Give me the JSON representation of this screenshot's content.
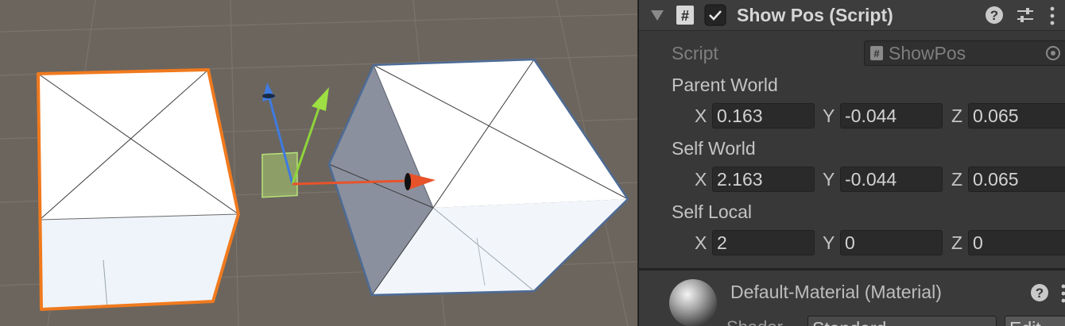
{
  "scene_view": {
    "objects": [
      "selected-cube",
      "cube",
      "move-gizmo"
    ]
  },
  "component": {
    "title": "Show Pos (Script)",
    "enabled": true,
    "script_label": "Script",
    "script_value": "ShowPos",
    "groups": [
      {
        "label": "Parent World",
        "x": "0.163",
        "y": "-0.044",
        "z": "0.065"
      },
      {
        "label": "Self World",
        "x": "2.163",
        "y": "-0.044",
        "z": "0.065"
      },
      {
        "label": "Self Local",
        "x": "2",
        "y": "0",
        "z": "0"
      }
    ],
    "axis_labels": {
      "x": "X",
      "y": "Y",
      "z": "Z"
    },
    "icons": [
      "foldout-arrow-icon",
      "script-hash-icon",
      "checkbox-icon",
      "help-icon",
      "settings-sliders-icon",
      "kebab-menu-icon",
      "object-picker-icon"
    ]
  },
  "material": {
    "title": "Default-Material (Material)",
    "shader_label": "Shader",
    "shader_value": "Standard",
    "edit_label": "Edit"
  },
  "colors": {
    "selection_outline": "#f07a1e",
    "gizmo_x": "#e8532a",
    "gizmo_y": "#8fd53a",
    "gizmo_z": "#3f7be0",
    "scene_bg": "#6b655e",
    "inspector_bg": "#383838"
  }
}
